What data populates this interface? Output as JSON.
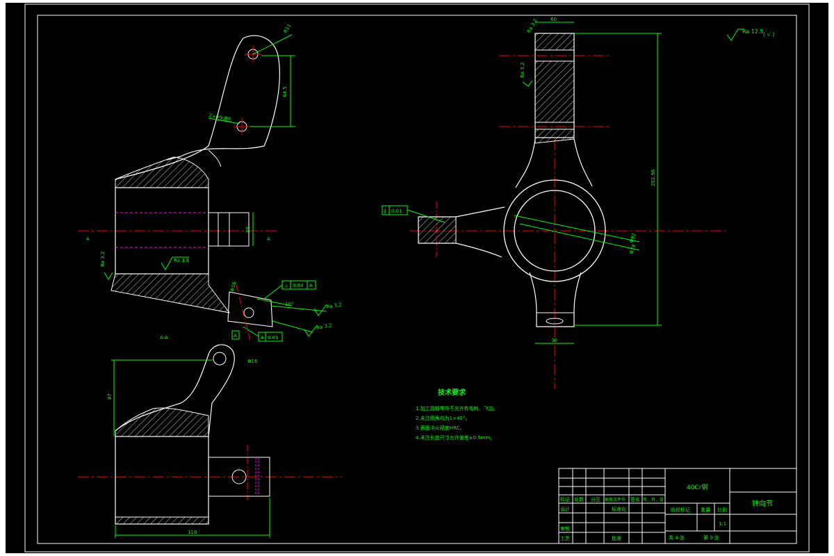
{
  "colors": {
    "paper": "#ffffff",
    "sheet": "#000000",
    "outline": "#ffffff",
    "dimension": "#00ff00",
    "centerline": "#ff0000",
    "hidden": "#ff00ff",
    "text": "#00ff00"
  },
  "view_side": {
    "dim_r": "R11",
    "dim_64": "64.5",
    "dim_hole": "2×Φ9通孔",
    "dim_h": "30",
    "section_a_left": "A",
    "section_a_right": "A",
    "rough_left": "Ra 3.2",
    "rough_mid": "Ra 3.6",
    "dim_bore": "Φ18",
    "dim_angle": "10°",
    "rough_r1": "Ra 3.2",
    "rough_r2": "Ra 3.2",
    "tol1": [
      "⊥",
      "0.04",
      "A"
    ],
    "tol2": [
      "A",
      "0.01"
    ],
    "datum": "A"
  },
  "view_bottom": {
    "section_label": "A-A",
    "dim_height": "87",
    "dim_dia": "Φ16",
    "dim_width": "118"
  },
  "view_front": {
    "top_dim": "60",
    "rough_side": "Ra 3.2",
    "rough_top": "Ra 3.2",
    "total_height": "252.96",
    "bore1": "Φ92",
    "bore2": "Φ78",
    "bottom_dim": "30",
    "tol": [
      "∥",
      "0.01"
    ],
    "roughness_note": "Ra 12.5",
    "roughness_paren": "( √ )"
  },
  "tech_requirements": {
    "title": "技术要求",
    "items": [
      "1.加工后钢零件不允许有毛刺、飞边。",
      "2.未注倒角均为1×45°。",
      "3.表面淬火硬度HRC。",
      "4.未注长度尺寸允许偏差±0.5mm。"
    ]
  },
  "title_block": {
    "material": "40Cr钢",
    "part_name": "转向节",
    "header_cells": [
      "标记",
      "处数",
      "分区",
      "更改文件号",
      "签名",
      "年、月、日"
    ],
    "stage_label": "阶段标记",
    "weight_label": "重量",
    "scale_label": "比例",
    "scale_value": "1:1",
    "design_label": "设计",
    "standard_label": "标准化",
    "review_label": "审核",
    "process_label": "工艺",
    "approve_label": "批准",
    "sheets": "共 4 张",
    "sheet_no": "第 3 张"
  }
}
